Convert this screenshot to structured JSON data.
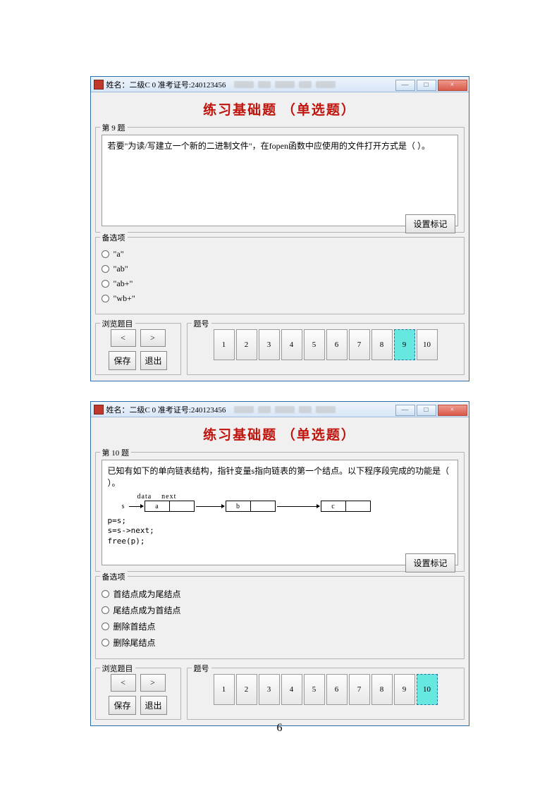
{
  "page_number": "6",
  "window_controls": {
    "min": "—",
    "max": "□",
    "close": "×"
  },
  "win1": {
    "title": "姓名：二级C 0 准考证号:240123456",
    "heading": "练习基础题 （单选题）",
    "question_group_legend": "第 9 题",
    "question_text": "若要\"为读/写建立一个新的二进制文件\"，在fopen函数中应使用的文件打开方式是（   ）。",
    "mark_button": "设置标记",
    "answers_legend": "备选项",
    "options": [
      "\"a\"",
      "\"ab\"",
      "\"ab+\"",
      "\"wb+\""
    ],
    "nav_legend": "浏览题目",
    "nav_buttons": {
      "prev": "<",
      "next": ">",
      "save": "保存",
      "exit": "退出"
    },
    "qnums_legend": "题号",
    "qnums": [
      "1",
      "2",
      "3",
      "4",
      "5",
      "6",
      "7",
      "8",
      "9",
      "10"
    ],
    "active_qnum_index": 8
  },
  "win2": {
    "title": "姓名：二级C 0 准考证号:240123456",
    "heading": "练习基础题 （单选题）",
    "question_group_legend": "第 10 题",
    "question_text": "已知有如下的单向链表结构，指针变量s指向链表的第一个结点。以下程序段完成的功能是（   ）。",
    "diagram": {
      "col_labels": [
        "data",
        "next"
      ],
      "s_label": "s",
      "nodes": [
        "a",
        "b",
        "c"
      ]
    },
    "code_lines": [
      "p=s;",
      "s=s->next;",
      "free(p);"
    ],
    "mark_button": "设置标记",
    "answers_legend": "备选项",
    "options": [
      "首结点成为尾结点",
      "尾结点成为首结点",
      "删除首结点",
      "删除尾结点"
    ],
    "nav_legend": "浏览题目",
    "nav_buttons": {
      "prev": "<",
      "next": ">",
      "save": "保存",
      "exit": "退出"
    },
    "qnums_legend": "题号",
    "qnums": [
      "1",
      "2",
      "3",
      "4",
      "5",
      "6",
      "7",
      "8",
      "9",
      "10"
    ],
    "active_qnum_index": 9
  }
}
